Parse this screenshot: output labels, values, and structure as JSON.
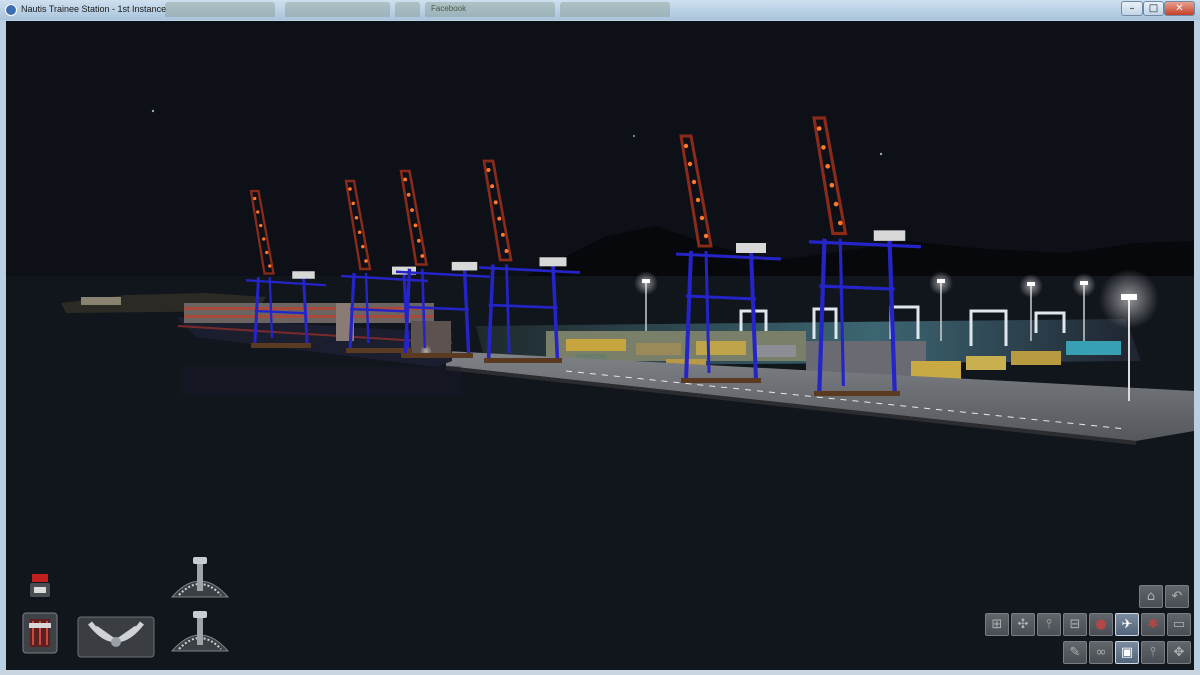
{
  "window": {
    "title": "Nautis Trainee Station - 1st Instance",
    "min_symbol": "–",
    "max_symbol": "□",
    "close_symbol": "✕"
  },
  "background_tabs": [
    "",
    "",
    "",
    "Facebook",
    ""
  ],
  "scene": {
    "description_colors": {
      "sky": "#0c0f14",
      "water": "#10141b",
      "crane": "#2a2ad0",
      "crane_top": "#8a2a1a",
      "quay": "#6c6f73"
    }
  },
  "controls": {
    "alarm_light": {
      "icon": "alarm-lamp-icon"
    },
    "engine_telegraph": {
      "icon": "engine-telegraph-icon"
    },
    "steering_wheel": {
      "icon": "steering-wheel-icon"
    },
    "thruster_upper": {
      "icon": "thruster-dial-icon"
    },
    "thruster_lower": {
      "icon": "thruster-dial-icon"
    }
  },
  "camera_toolbar": {
    "row1": [
      {
        "icon": "camera-home-icon",
        "glyph": "⌂",
        "active": false
      },
      {
        "icon": "camera-undo-icon",
        "glyph": "↶",
        "active": false
      }
    ],
    "row2": [
      {
        "icon": "ship-view-icon",
        "glyph": "⊞",
        "active": false
      },
      {
        "icon": "crane-view-icon",
        "glyph": "✣",
        "active": false
      },
      {
        "icon": "mast-view-icon",
        "glyph": "⫯",
        "active": false
      },
      {
        "icon": "deck-view-icon",
        "glyph": "⊟",
        "active": false
      },
      {
        "icon": "buoy-view-icon",
        "glyph": "●",
        "active": false,
        "red": true
      },
      {
        "icon": "free-camera-icon",
        "glyph": "✈",
        "active": true
      },
      {
        "icon": "tug-view-icon",
        "glyph": "✱",
        "active": false,
        "red": true
      },
      {
        "icon": "ground-view-icon",
        "glyph": "▭",
        "active": false
      }
    ],
    "row3": [
      {
        "icon": "pencil-tool-icon",
        "glyph": "✎",
        "active": false
      },
      {
        "icon": "link-tool-icon",
        "glyph": "∞",
        "active": false
      },
      {
        "icon": "video-camera-icon",
        "glyph": "▣",
        "active": true
      },
      {
        "icon": "mast-camera-icon",
        "glyph": "⫯",
        "active": false
      },
      {
        "icon": "orbit-camera-icon",
        "glyph": "✥",
        "active": false
      }
    ]
  }
}
